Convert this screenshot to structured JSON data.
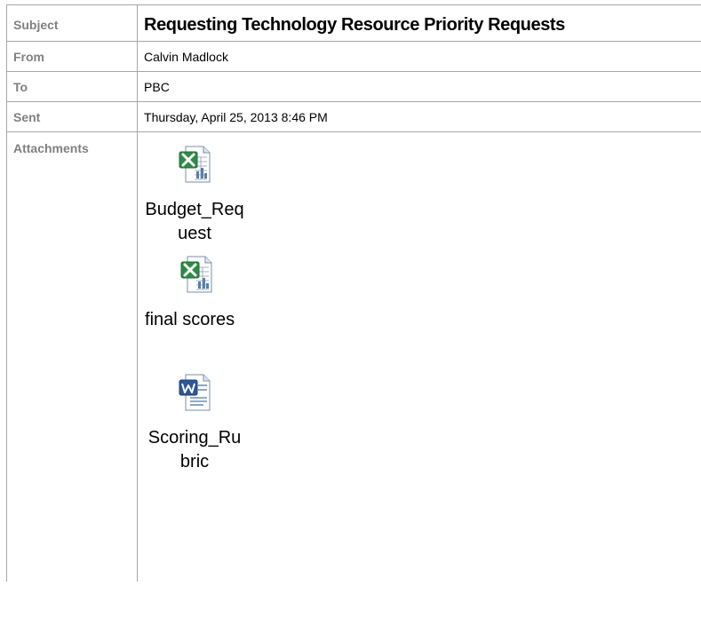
{
  "header": {
    "subject_label": "Subject",
    "subject_value": "Requesting Technology Resource Priority Requests",
    "from_label": "From",
    "from_value": "Calvin Madlock",
    "to_label": "To",
    "to_value": "PBC",
    "sent_label": "Sent",
    "sent_value": "Thursday, April 25, 2013 8:46 PM",
    "attachments_label": "Attachments"
  },
  "attachments": [
    {
      "name": "Budget_Request",
      "icon": "excel-file-icon"
    },
    {
      "name": "final scores",
      "icon": "excel-file-icon"
    },
    {
      "name": "Scoring_Rubric",
      "icon": "word-file-icon"
    }
  ],
  "colors": {
    "label_gray": "#808080",
    "border_gray": "#a6a6a6",
    "excel_green": "#1f7a3a",
    "word_blue": "#2b5797"
  }
}
